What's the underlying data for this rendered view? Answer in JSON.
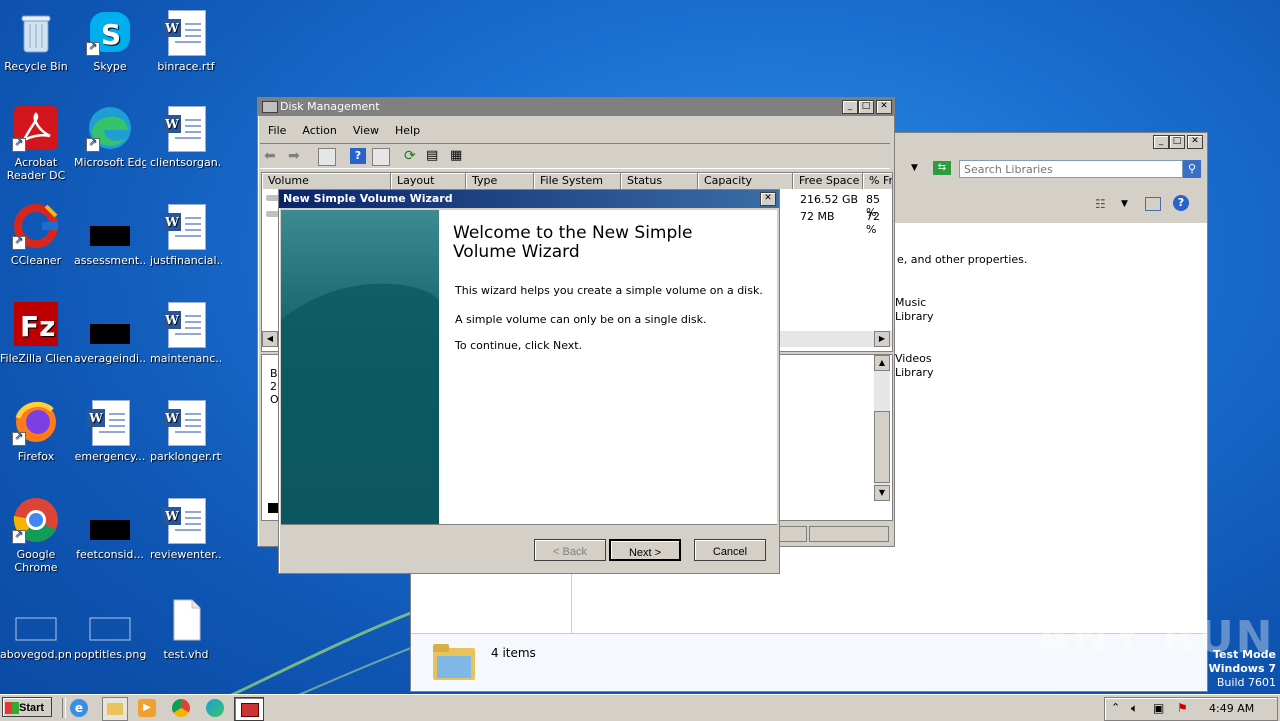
{
  "desktop": {
    "icons": [
      {
        "label": "Recycle Bin"
      },
      {
        "label": "Skype"
      },
      {
        "label": "binrace.rtf"
      },
      {
        "label": "Acrobat Reader DC"
      },
      {
        "label": "Microsoft Edge"
      },
      {
        "label": "clientsorgan..."
      },
      {
        "label": "CCleaner"
      },
      {
        "label": "assessment..."
      },
      {
        "label": "justfinancial..."
      },
      {
        "label": "FileZilla Client"
      },
      {
        "label": "averageindi..."
      },
      {
        "label": "maintenanc..."
      },
      {
        "label": "Firefox"
      },
      {
        "label": "emergency..."
      },
      {
        "label": "parklonger.rtf"
      },
      {
        "label": "Google Chrome"
      },
      {
        "label": "feetconsid..."
      },
      {
        "label": "reviewenter..."
      },
      {
        "label": "abovegod.png"
      },
      {
        "label": "poptitles.png"
      },
      {
        "label": "test.vhd"
      }
    ],
    "watermark": "ANY RUN",
    "test_mode": {
      "line1": "Test Mode",
      "line2": "Windows 7",
      "line3": "Build 7601"
    }
  },
  "disk_management": {
    "title": "Disk Management",
    "menu": [
      "File",
      "Action",
      "View",
      "Help"
    ],
    "columns": [
      "Volume",
      "Layout",
      "Type",
      "File System",
      "Status",
      "Capacity",
      "Free Space",
      "% Fr"
    ],
    "rows": [
      {
        "free": "216.52 GB",
        "pct": "85 %"
      },
      {
        "free": "72 MB",
        "pct": "72 %"
      }
    ],
    "lower_pane_text": [
      "B",
      "2",
      "O"
    ]
  },
  "libraries": {
    "search_placeholder": "Search Libraries",
    "description_fragment": "e, and other properties.",
    "items": [
      {
        "line1": "Music",
        "line2": "Library"
      },
      {
        "line1": "Videos",
        "line2": "Library"
      }
    ],
    "status": "4 items"
  },
  "wizard": {
    "title": "New Simple Volume Wizard",
    "heading": "Welcome to the New Simple Volume Wizard",
    "heading_line1": "Welcome to the New Simple",
    "heading_line2": "Volume Wizard",
    "para1": "This wizard helps you create a simple volume on a disk.",
    "para2": "A simple volume can only be on a single disk.",
    "para3": "To continue, click Next.",
    "back_label": "< Back",
    "next_label": "Next >",
    "cancel_label": "Cancel"
  },
  "taskbar": {
    "start_label": "Start",
    "clock": "4:49 AM"
  },
  "colors": {
    "title_active": "#0a246a",
    "title_inactive": "#808080",
    "wizard_panel": "#0f5f66"
  }
}
